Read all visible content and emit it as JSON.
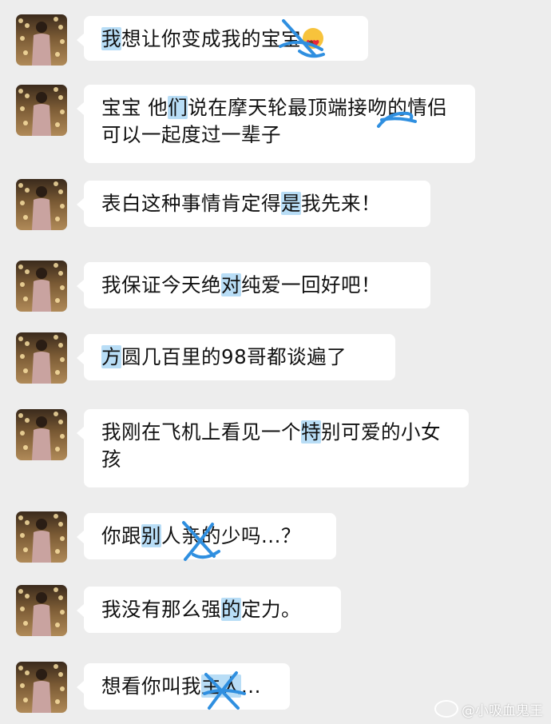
{
  "messages": [
    {
      "before": "",
      "hl": "我",
      "after": "想让你变成我的",
      "hl2": "",
      "tail": "宝宝",
      "emoji": "smiling-face-with-heart-eyes"
    },
    {
      "before": "宝宝 他",
      "hl": "们",
      "after": "说在摩天轮最顶端接吻的情侣可以一起度过一辈子"
    },
    {
      "before": "表白这种事情肯定得",
      "hl": "是",
      "after": "我先来！"
    },
    {
      "before": "我保证今天绝",
      "hl": "对",
      "after": "纯爱一回好吧！"
    },
    {
      "before": "",
      "hl": "方",
      "after": "圆几百里的98哥都谈遍了"
    },
    {
      "before": "我刚在飞机上看见一个",
      "hl": "特",
      "after": "别可爱的小女孩"
    },
    {
      "before": "你跟",
      "hl": "别",
      "after": "人亲的少吗...？"
    },
    {
      "before": "我没有那么强",
      "hl": "的",
      "after": "定力。"
    },
    {
      "before": "想看你叫我",
      "hl": "主人",
      "after": "..."
    }
  ],
  "watermark": "@小吸血鬼王",
  "colors": {
    "bubble": "#ffffff",
    "background": "#ededed",
    "highlight": "#acd7f5",
    "scribble": "#2f8fe0"
  }
}
